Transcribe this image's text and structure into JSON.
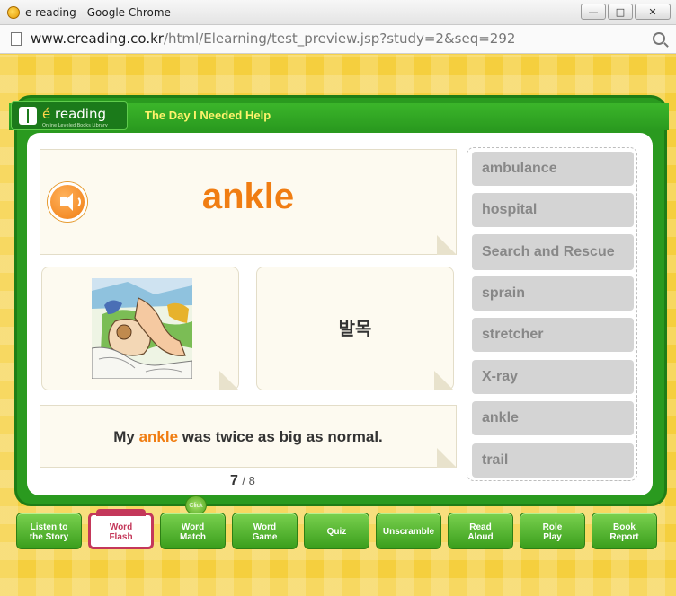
{
  "window": {
    "title": "e reading - Google Chrome",
    "buttons": [
      "minimize",
      "maximize",
      "close"
    ]
  },
  "address_bar": {
    "host": "www.ereading.co.kr",
    "path": "/html/Elearning/test_preview.jsp?study=2&seq=292"
  },
  "header": {
    "logo_e": "é",
    "logo_text": " reading",
    "logo_sub": "Online Leveled Books Library",
    "story_title": "The Day I Needed Help"
  },
  "card": {
    "word": "ankle",
    "meaning": "발목",
    "sentence_before": "My ",
    "sentence_highlight": "ankle",
    "sentence_after": " was twice as big as normal."
  },
  "counter": {
    "current": "7",
    "total": "/ 8"
  },
  "word_list": [
    "ambulance",
    "hospital",
    "Search and Rescue",
    "sprain",
    "stretcher",
    "X-ray",
    "ankle",
    "trail"
  ],
  "nav": {
    "items": [
      "Listen to\nthe Story",
      "Word\nFlash",
      "Word\nMatch",
      "Word\nGame",
      "Quiz",
      "Unscramble",
      "Read\nAloud",
      "Role\nPlay",
      "Book\nReport"
    ],
    "active_index": 1,
    "click_badge": "Click"
  },
  "colors": {
    "accent_orange": "#f07d12",
    "frame_green": "#2a9a1f",
    "active_tab": "#c4385a"
  }
}
